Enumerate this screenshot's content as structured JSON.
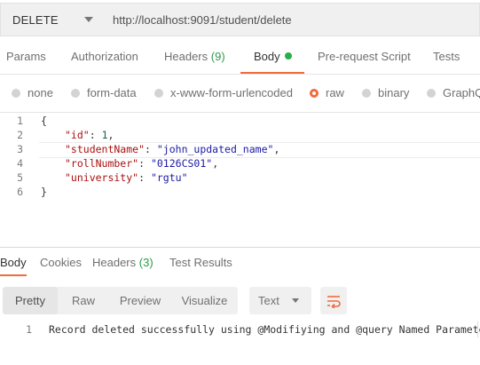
{
  "request": {
    "method": "DELETE",
    "url": "http://localhost:9091/student/delete"
  },
  "request_tabs": {
    "params": "Params",
    "authorization": "Authorization",
    "headers_label": "Headers",
    "headers_count": "(9)",
    "body": "Body",
    "pre_request_script": "Pre-request Script",
    "tests": "Tests"
  },
  "body_types": {
    "none": "none",
    "form_data": "form-data",
    "urlencoded": "x-www-form-urlencoded",
    "raw": "raw",
    "binary": "binary",
    "graphql": "GraphQ",
    "selected": "raw"
  },
  "editor": {
    "line_numbers": [
      "1",
      "2",
      "3",
      "4",
      "5",
      "6"
    ],
    "open_brace": "{",
    "close_brace": "}",
    "fields": [
      {
        "key": "\"id\"",
        "sep": ": ",
        "value": "1",
        "trail": ","
      },
      {
        "key": "\"studentName\"",
        "sep": ": ",
        "value": "\"john_updated_name\"",
        "trail": ","
      },
      {
        "key": "\"rollNumber\"",
        "sep": ": ",
        "value": "\"0126CS01\"",
        "trail": ","
      },
      {
        "key": "\"university\"",
        "sep": ": ",
        "value": "\"rgtu\"",
        "trail": ""
      }
    ]
  },
  "response_tabs": {
    "body": "Body",
    "cookies": "Cookies",
    "headers_label": "Headers",
    "headers_count": "(3)",
    "test_results": "Test Results"
  },
  "response_view": {
    "pretty": "Pretty",
    "raw": "Raw",
    "preview": "Preview",
    "visualize": "Visualize",
    "format": "Text",
    "wrap_icon": "wrap-lines-icon"
  },
  "response_body": {
    "line_number": "1",
    "text": "Record deleted successfully using @Modifiying and @query Named Parameter"
  },
  "colors": {
    "accent": "#f26b3a",
    "active_dot": "#26b047",
    "count": "#2e9a4a"
  }
}
